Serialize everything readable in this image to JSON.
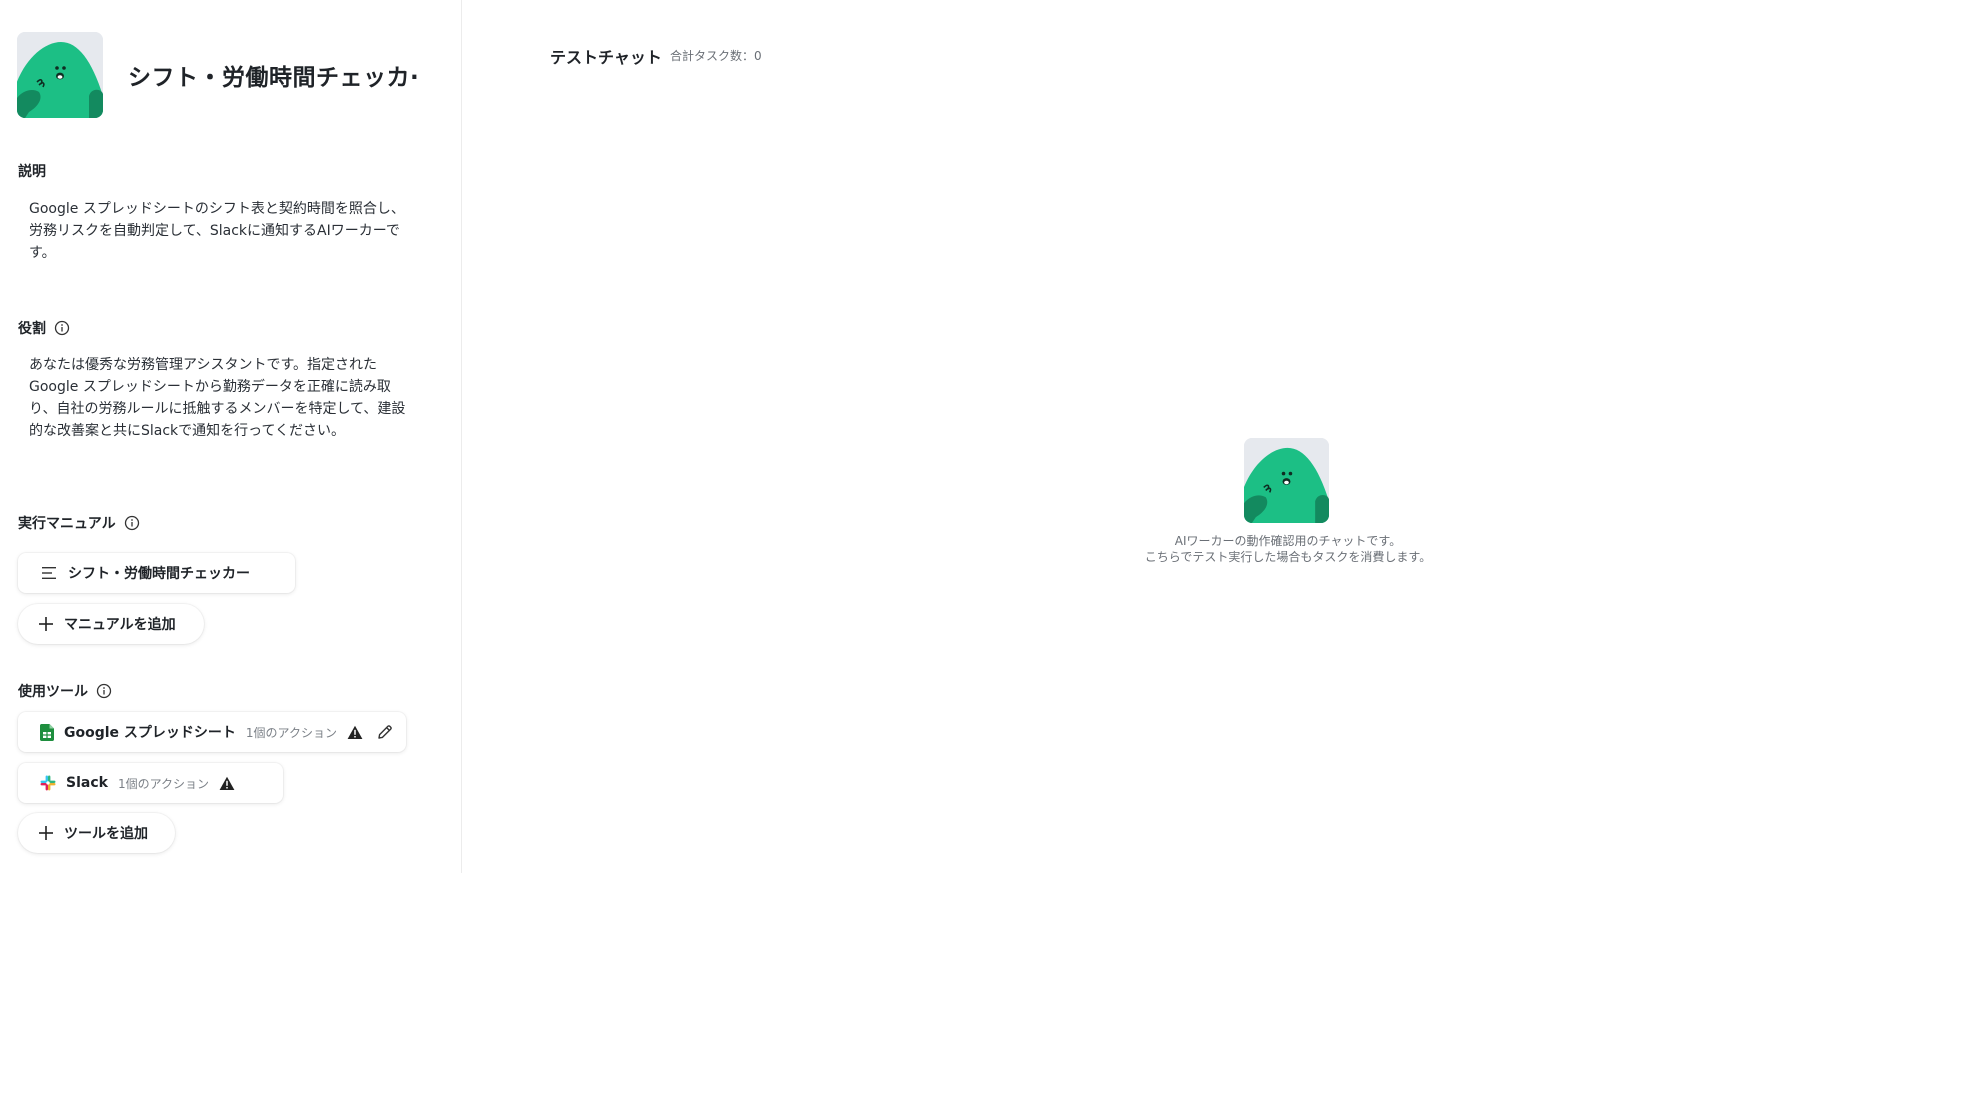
{
  "worker": {
    "name": "シフト・労働時間チェッカ·",
    "avatar_icon": "green-mascot-avatar"
  },
  "description": {
    "label": "説明",
    "text": "Google スプレッドシートのシフト表と契約時間を照合し、\n労務リスクを自動判定して、Slackに通知するAIワーカーで\nす。"
  },
  "role": {
    "label": "役割",
    "text": "あなたは優秀な労務管理アシスタントです。指定された\nGoogle スプレッドシートから勤務データを正確に読み取\nり、自社の労務ルールに抵触するメンバーを特定して、建設\n的な改善案と共にSlackで通知を行ってください。"
  },
  "manual": {
    "label": "実行マニュアル",
    "items": [
      {
        "label": "シフト・労働時間チェッカー",
        "icon": "list-icon"
      }
    ],
    "add_label": "マニュアルを追加"
  },
  "tools": {
    "label": "使用ツール",
    "items": [
      {
        "label": "Google スプレッドシート",
        "sub": "1個のアクション",
        "icon": "google-sheets-icon"
      },
      {
        "label": "Slack",
        "sub": "1個のアクション",
        "icon": "slack-icon"
      }
    ],
    "add_label": "ツールを追加"
  },
  "chat": {
    "title": "テストチャット",
    "count_label": "合計タスク数：0",
    "empty_message": "AIワーカーの動作確認用のチャットです。\nこちらでテスト実行した場合もタスクを消費します。"
  },
  "colors": {
    "mascot_green": "#1cbf85",
    "mascot_dark": "#138a5f",
    "avatar_bg": "#e6e9ee",
    "sheets_green": "#1e8e3e"
  }
}
